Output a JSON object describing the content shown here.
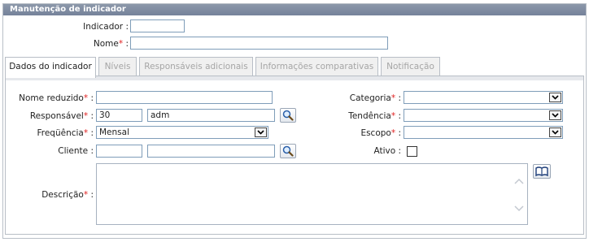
{
  "panel": {
    "title": "Manutenção de indicador"
  },
  "header_form": {
    "indicador_label": "Indicador :",
    "nome_label": "Nome",
    "nome_suffix": " :",
    "indicador_value": "",
    "nome_value": ""
  },
  "tabs": [
    {
      "label": "Dados do indicador",
      "active": true
    },
    {
      "label": "Níveis",
      "active": false
    },
    {
      "label": "Responsáveis adicionais",
      "active": false
    },
    {
      "label": "Informações comparativas",
      "active": false
    },
    {
      "label": "Notificação",
      "active": false
    }
  ],
  "form": {
    "nome_reduzido_label": "Nome reduzido",
    "nome_reduzido_value": "",
    "responsavel_label": "Responsável",
    "responsavel_code": "30",
    "responsavel_name": "adm",
    "frequencia_label": "Freqüência",
    "frequencia_value": "Mensal",
    "cliente_label": "Cliente :",
    "cliente_code": "",
    "cliente_name": "",
    "descricao_label": "Descrição",
    "descricao_value": "",
    "categoria_label": "Categoria",
    "categoria_value": "",
    "tendencia_label": "Tendência",
    "tendencia_value": "",
    "escopo_label": "Escopo",
    "escopo_value": "",
    "ativo_label": "Ativo :",
    "required_mark": "*",
    "colon": " :"
  },
  "icons": {
    "search": "search-icon",
    "dropdown": "chevron-down-icon",
    "book": "book-icon"
  },
  "colors": {
    "title_bar": "#7b879d",
    "required": "#e02020",
    "border": "#7f9db9",
    "tab_inactive_text": "#a5a5a5"
  }
}
